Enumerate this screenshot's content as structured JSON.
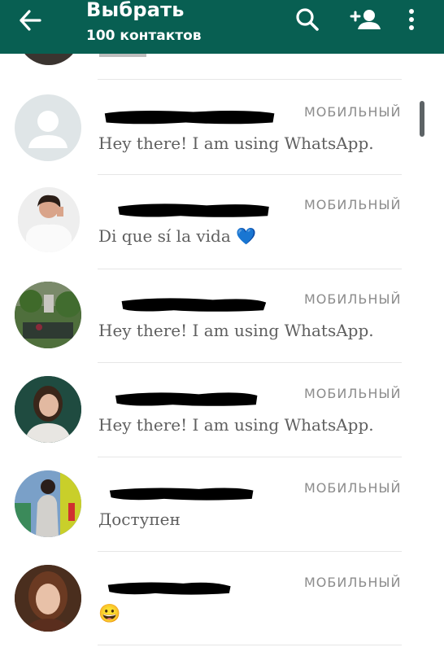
{
  "header": {
    "title": "Выбрать",
    "subtitle": "100 контактов",
    "bg_color": "#085f52"
  },
  "icons": {
    "back": "arrow-left-icon",
    "search": "search-icon",
    "add_contact": "add-person-icon",
    "more": "more-vert-icon"
  },
  "contacts": [
    {
      "badge": "МОБИЛЬНЫЙ",
      "status": "Hey there! I am using WhatsApp."
    },
    {
      "badge": "МОБИЛЬНЫЙ",
      "status": "Di que sí la vida 💙"
    },
    {
      "badge": "МОБИЛЬНЫЙ",
      "status": "Hey there! I am using WhatsApp."
    },
    {
      "badge": "МОБИЛЬНЫЙ",
      "status": "Hey there! I am using WhatsApp."
    },
    {
      "badge": "МОБИЛЬНЫЙ",
      "status": "Доступен"
    },
    {
      "badge": "МОБИЛЬНЫЙ",
      "status": "😀"
    }
  ]
}
